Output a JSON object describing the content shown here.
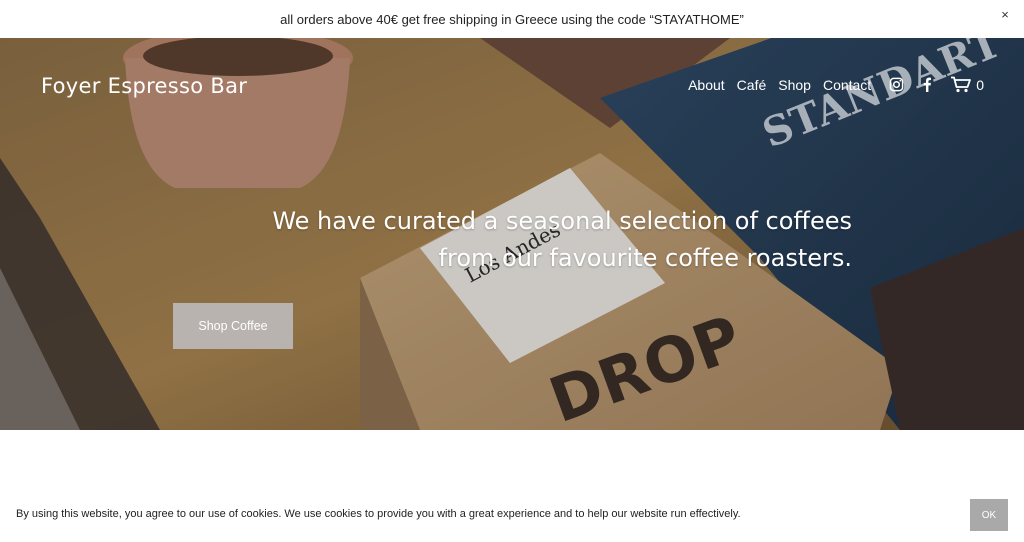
{
  "announcement": {
    "text": "all orders above 40€ get free shipping in Greece using the code “STAYATHOME”",
    "close_icon": "×"
  },
  "header": {
    "brand": "Foyer Espresso Bar",
    "nav": [
      "About",
      "Café",
      "Shop",
      "Contact"
    ],
    "icons": [
      "instagram-icon",
      "facebook-icon",
      "cart-icon"
    ],
    "cart_count": "0"
  },
  "hero": {
    "headline": "We have curated a seasonal selection of coffees from our favourite coffee roasters.",
    "button_label": "Shop Coffee"
  },
  "cookie_banner": {
    "text": "By using this website, you agree to our use of cookies. We use cookies to provide you with a great experience and to help our website run effectively.",
    "ok_label": "OK"
  },
  "colors": {
    "button_bg": "#b8b3ae",
    "ok_bg": "#a9a9a9"
  }
}
